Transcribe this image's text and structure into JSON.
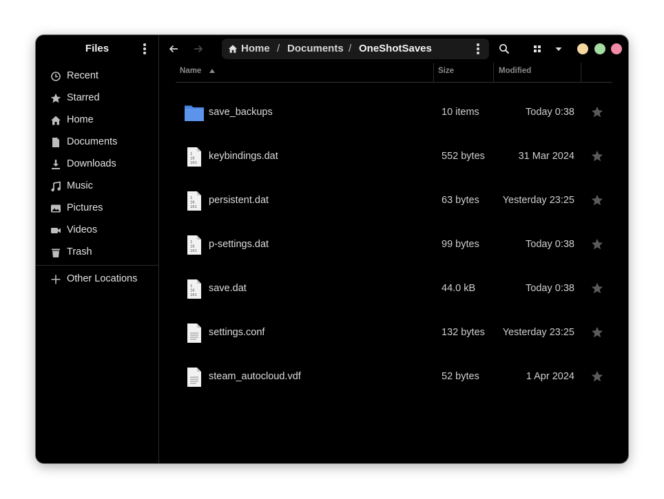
{
  "sidebar": {
    "title": "Files",
    "items": [
      {
        "label": "Recent",
        "icon": "clock-icon"
      },
      {
        "label": "Starred",
        "icon": "star-icon"
      },
      {
        "label": "Home",
        "icon": "home-icon"
      },
      {
        "label": "Documents",
        "icon": "document-icon"
      },
      {
        "label": "Downloads",
        "icon": "download-icon"
      },
      {
        "label": "Music",
        "icon": "music-icon"
      },
      {
        "label": "Pictures",
        "icon": "picture-icon"
      },
      {
        "label": "Videos",
        "icon": "video-icon"
      },
      {
        "label": "Trash",
        "icon": "trash-icon"
      }
    ],
    "other_locations": "Other Locations"
  },
  "pathbar": {
    "home": "Home",
    "sep": "/",
    "documents": "Documents",
    "current": "OneShotSaves"
  },
  "columns": {
    "name": "Name",
    "size": "Size",
    "modified": "Modified"
  },
  "files": [
    {
      "name": "save_backups",
      "size": "10 items",
      "modified": "Today 0:38",
      "type": "folder"
    },
    {
      "name": "keybindings.dat",
      "size": "552 bytes",
      "modified": "31 Mar 2024",
      "type": "binary"
    },
    {
      "name": "persistent.dat",
      "size": "63 bytes",
      "modified": "Yesterday 23:25",
      "type": "binary"
    },
    {
      "name": "p-settings.dat",
      "size": "99 bytes",
      "modified": "Today 0:38",
      "type": "binary"
    },
    {
      "name": "save.dat",
      "size": "44.0 kB",
      "modified": "Today 0:38",
      "type": "binary"
    },
    {
      "name": "settings.conf",
      "size": "132 bytes",
      "modified": "Yesterday 23:25",
      "type": "text"
    },
    {
      "name": "steam_autocloud.vdf",
      "size": "52 bytes",
      "modified": "1 Apr 2024",
      "type": "text"
    }
  ],
  "window_controls": {
    "minimize_color": "#f6d9a0",
    "maximize_color": "#a6dda2",
    "close_color": "#f28ba5"
  },
  "colors": {
    "folder": "#4a86e0",
    "background": "#000000"
  }
}
